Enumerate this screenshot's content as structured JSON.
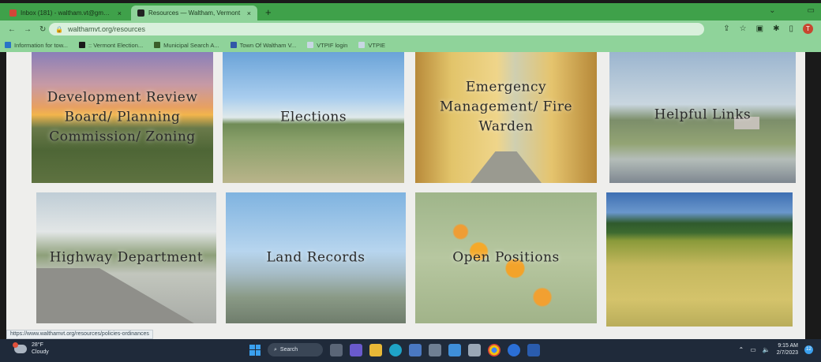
{
  "browser": {
    "tabs": [
      {
        "label": "Inbox (181) - waltham.vt@gmai...",
        "close": "×",
        "favicon_color": "#d44638"
      },
      {
        "label": "Resources — Waltham, Vermont",
        "close": "×",
        "favicon_color": "#222222"
      }
    ],
    "new_tab": "+",
    "address": "walthamvt.org/resources",
    "bookmarks": [
      {
        "label": "Information for tow...",
        "color": "#2a73c7"
      },
      {
        "label": ":: Vermont Election...",
        "color": "#1a1a1a"
      },
      {
        "label": "Municipal Search A...",
        "color": "#3a5f2a"
      },
      {
        "label": "Town Of Waltham V...",
        "color": "#3257a8"
      },
      {
        "label": "VTPIF login",
        "color": "#c8d7e3"
      },
      {
        "label": "VTPIE",
        "color": "#c8d7e3"
      }
    ],
    "profile_initial": "T"
  },
  "resources": [
    {
      "label": "Development Review Board/ Planning Commission/ Zoning"
    },
    {
      "label": "Elections"
    },
    {
      "label": "Emergency Management/ Fire Warden"
    },
    {
      "label": "Helpful Links"
    },
    {
      "label": "Highway Department"
    },
    {
      "label": "Land Records"
    },
    {
      "label": "Open Positions"
    },
    {
      "label": ""
    }
  ],
  "status_url": "https://www.walthamvt.org/resources/policies-ordinances",
  "taskbar": {
    "temperature": "28°F",
    "condition": "Cloudy",
    "search_label": "Search",
    "time": "9:15 AM",
    "date": "2/7/2023",
    "notifications": "12"
  },
  "colors": {
    "browser_accent": "#3fa14a",
    "toolbar": "#8fd39a",
    "taskbar": "#1f2a3a"
  }
}
